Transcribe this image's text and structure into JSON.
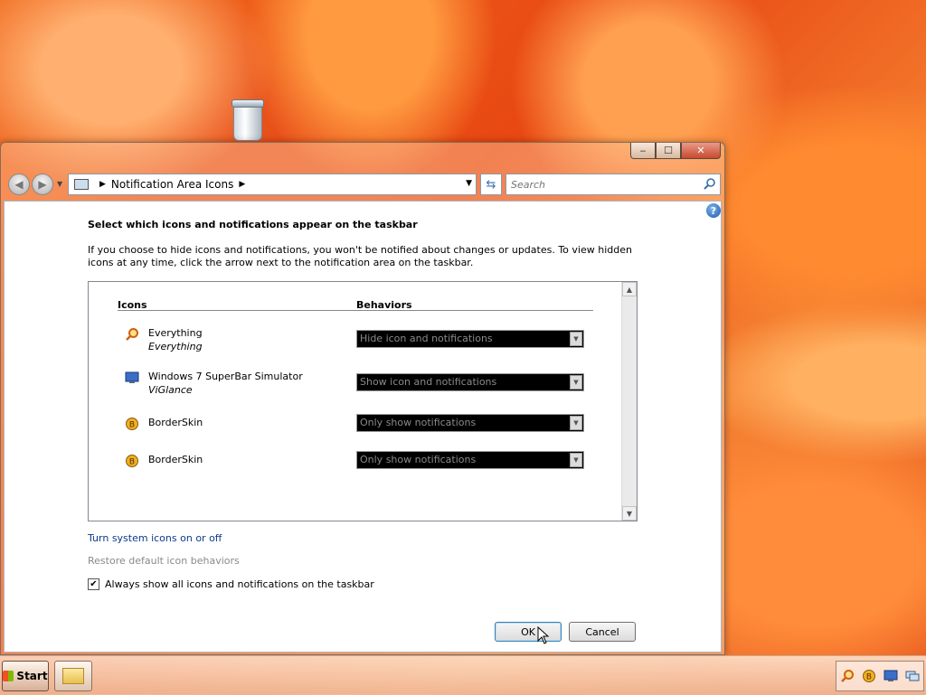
{
  "desktop": {
    "recycle_bin": {
      "icon": "recycle-bin-icon"
    }
  },
  "window": {
    "caption": {
      "minimize": "‒",
      "maximize": "☐",
      "close": "✕"
    },
    "nav": {
      "back_icon": "back-arrow-icon",
      "forward_icon": "forward-arrow-icon",
      "address": {
        "location": "Notification Area Icons"
      },
      "search": {
        "placeholder": "Search"
      }
    },
    "content": {
      "heading": "Select which icons and notifications appear on the taskbar",
      "description": "If you choose to hide icons and notifications, you won't be notified about changes or updates. To view hidden icons at any time, click the arrow next to the notification area on the taskbar.",
      "list": {
        "col_icons": "Icons",
        "col_behaviors": "Behaviors",
        "rows": [
          {
            "name": "Everything",
            "publisher": "Everything",
            "behavior": "Hide icon and notifications",
            "icon": "magnifier-icon"
          },
          {
            "name": "Windows 7 SuperBar Simulator",
            "publisher": "ViGlance",
            "behavior": "Show icon and notifications",
            "icon": "monitor-icon"
          },
          {
            "name": "BorderSkin",
            "publisher": "",
            "behavior": "Only show notifications",
            "icon": "borderskin-icon"
          },
          {
            "name": "BorderSkin",
            "publisher": "",
            "behavior": "Only show notifications",
            "icon": "borderskin-icon"
          }
        ]
      },
      "link_system_icons": "Turn system icons on or off",
      "link_restore": "Restore default icon behaviors",
      "checkbox_label": "Always show all icons and notifications on the taskbar",
      "checkbox_checked": true,
      "ok_label": "OK",
      "cancel_label": "Cancel"
    }
  },
  "taskbar": {
    "start_label": "Start",
    "tray_icons": [
      "magnifier-icon",
      "borderskin-icon",
      "monitor-icon",
      "network-icon"
    ]
  }
}
